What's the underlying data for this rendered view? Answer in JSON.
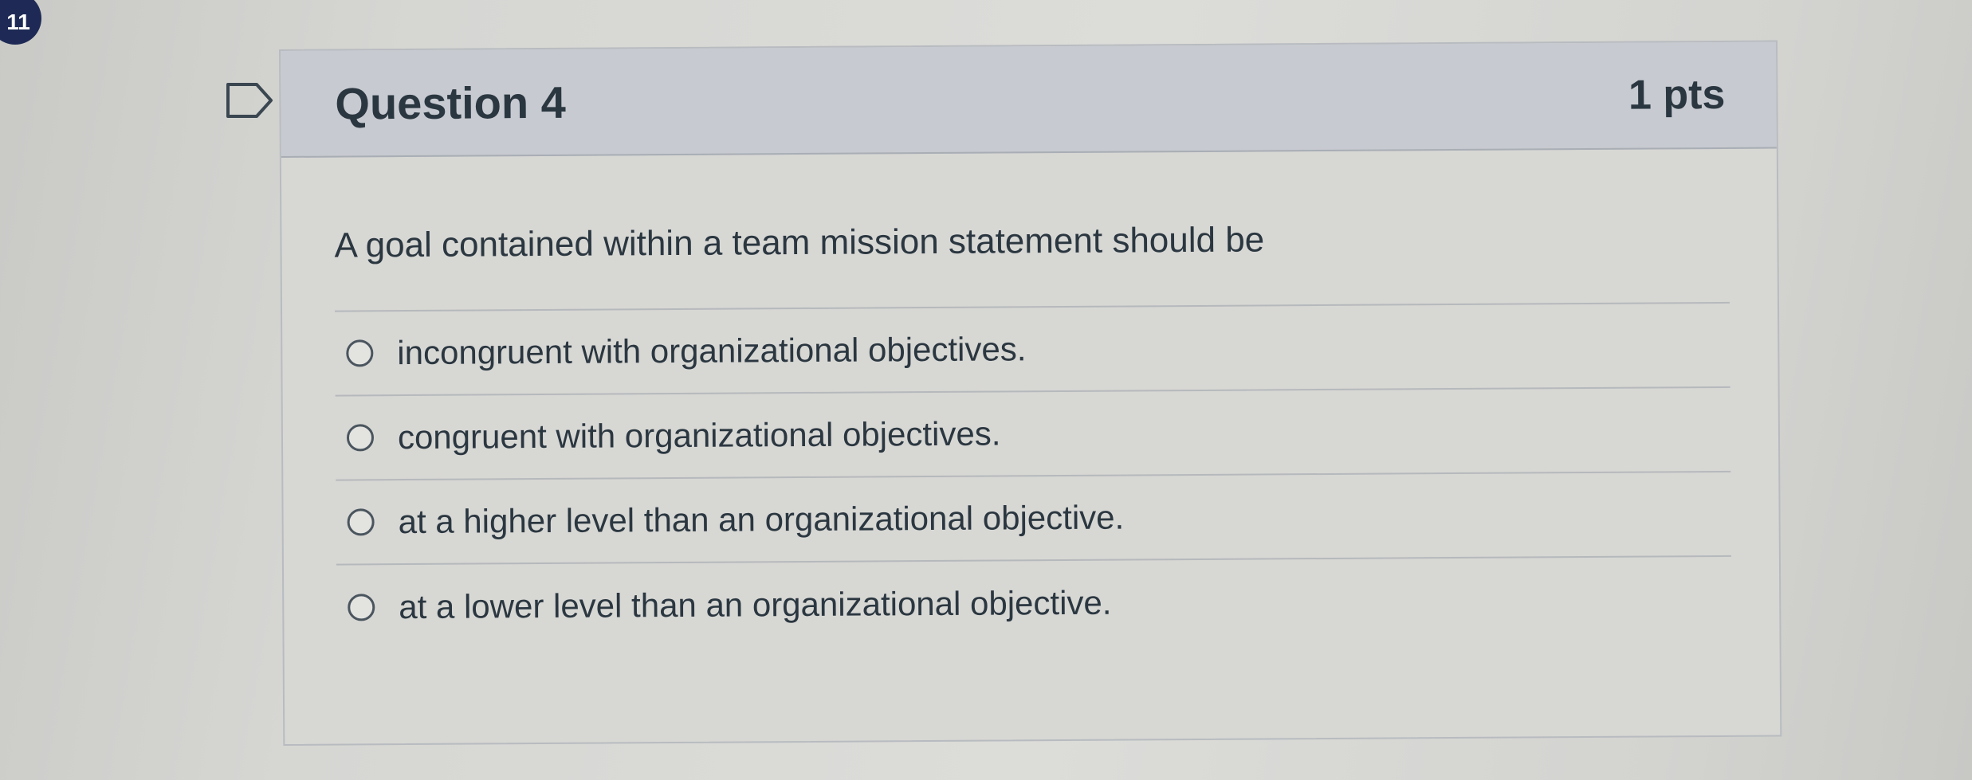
{
  "badge": {
    "count": "11"
  },
  "question": {
    "title": "Question 4",
    "points": "1 pts",
    "text": "A goal contained within a team mission statement should be",
    "answers": [
      {
        "label": "incongruent with organizational objectives."
      },
      {
        "label": "congruent with organizational objectives."
      },
      {
        "label": "at a higher level than an organizational objective."
      },
      {
        "label": "at a lower level than an organizational objective."
      }
    ]
  },
  "icons": {
    "flag": "flag-icon",
    "radio": "radio-unchecked-icon"
  },
  "colors": {
    "header_bg": "#c7cad0",
    "badge_bg": "#1e2a55",
    "text": "#2b3740"
  }
}
